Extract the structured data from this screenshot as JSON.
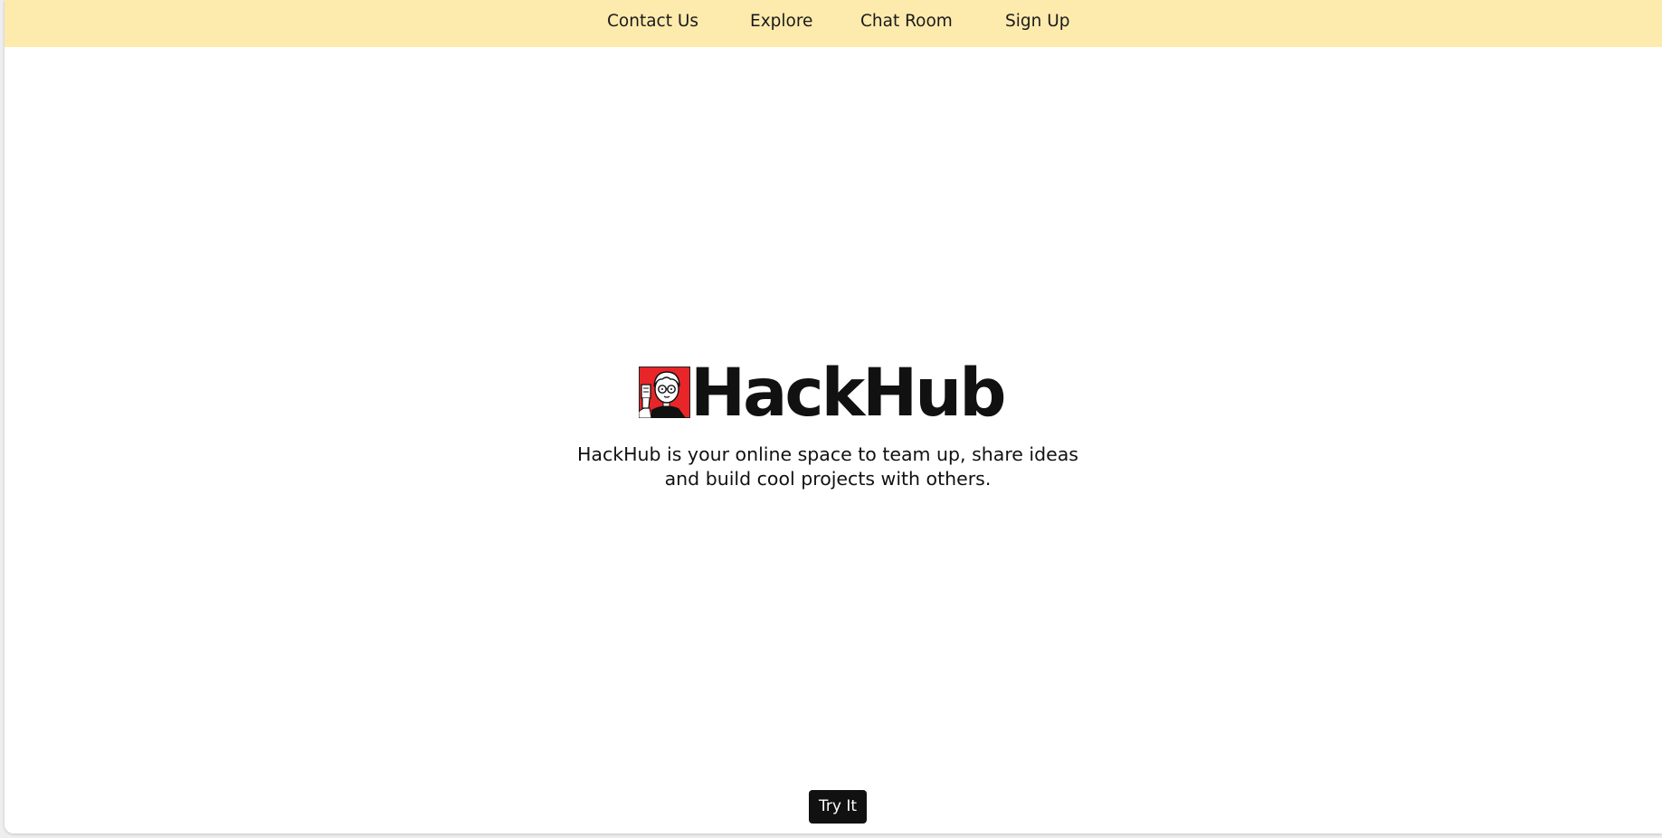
{
  "nav": {
    "items": [
      {
        "label": "Contact Us"
      },
      {
        "label": "Explore"
      },
      {
        "label": "Chat Room"
      },
      {
        "label": "Sign Up"
      }
    ]
  },
  "hero": {
    "logo_icon": "avatar-with-glasses-icon",
    "title": "HackHub",
    "tagline_line1": "HackHub is your online space to team up, share ideas",
    "tagline_line2": "and build cool projects with others."
  },
  "cta": {
    "label": "Try It"
  },
  "colors": {
    "navbar_bg": "#fdeaad",
    "logo_red": "#e8262a",
    "text": "#111111",
    "button_bg": "#111111",
    "button_text": "#ffffff"
  }
}
